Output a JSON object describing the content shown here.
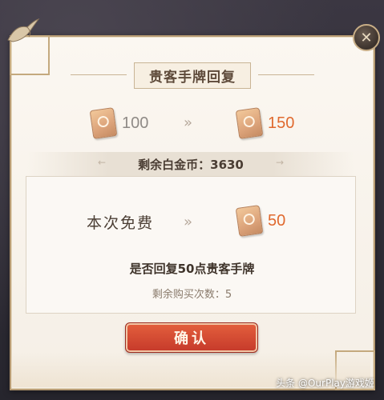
{
  "dialog": {
    "title": "贵客手牌回复",
    "current_amount": "100",
    "new_amount": "150",
    "arrow_glyph": "»",
    "coin_label": "剩余白金币：3630",
    "cost_label": "本次免费",
    "gain_amount": "50",
    "question": "是否回复50点贵客手牌",
    "remaining_purchases": "剩余购买次数：5",
    "confirm_label": "确认",
    "close_glyph": "✕"
  },
  "icons": {
    "token": "guest-token-icon",
    "close": "close-icon",
    "decor": "crane-bird-icon"
  },
  "colors": {
    "accent_orange": "#e0692e",
    "confirm_red": "#c5392a",
    "panel_bg": "#f8f3eb",
    "gray_text": "#8f8a86"
  },
  "watermark": "头条 @OurPlay游戏姬"
}
